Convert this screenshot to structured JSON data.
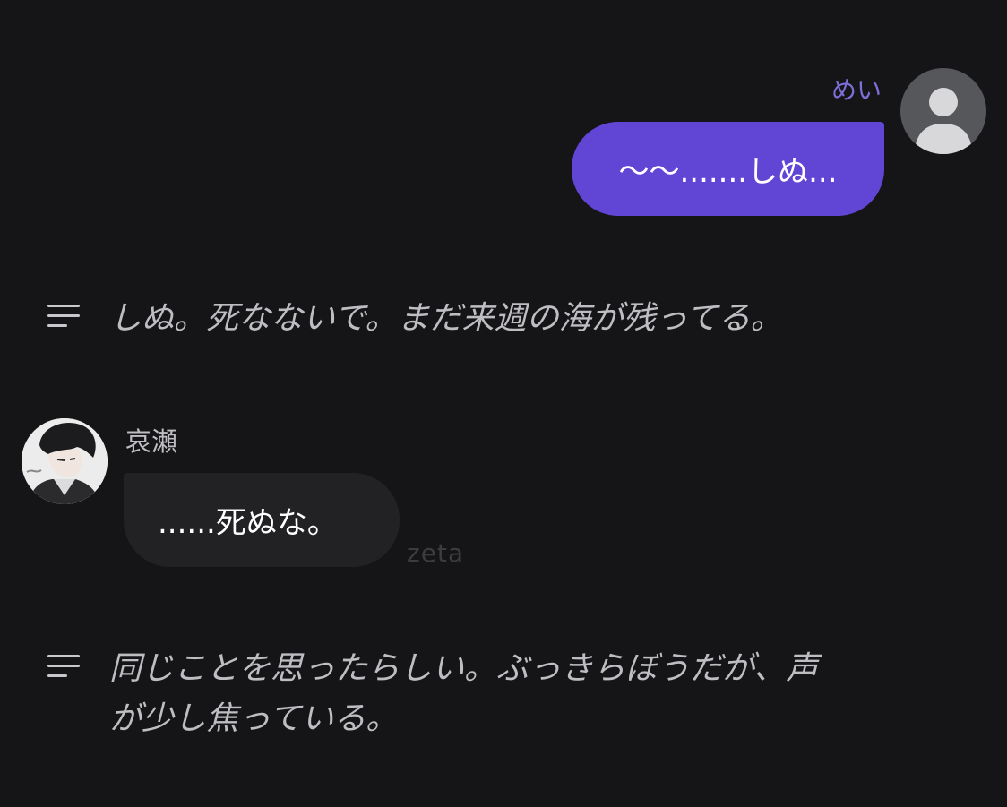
{
  "user_message": {
    "sender": "めい",
    "text": "～～.......しぬ..."
  },
  "narration_1": {
    "text": "しぬ。死なないで。まだ来週の海が残ってる。"
  },
  "character_message": {
    "sender": "哀瀬",
    "text": "......死ぬな。",
    "watermark": "zeta"
  },
  "narration_2": {
    "lines": [
      "同じことを思ったらしい。ぶっきらぼうだが、声",
      "が少し焦っている。"
    ]
  },
  "icons": {
    "user_avatar": "default-person-icon",
    "narration": "lines-menu-icon"
  },
  "colors": {
    "background": "#151517",
    "user_bubble": "#6146d5",
    "character_bubble": "#222224",
    "user_name": "#7c6fd8",
    "narration_text": "#bdbdc2"
  }
}
